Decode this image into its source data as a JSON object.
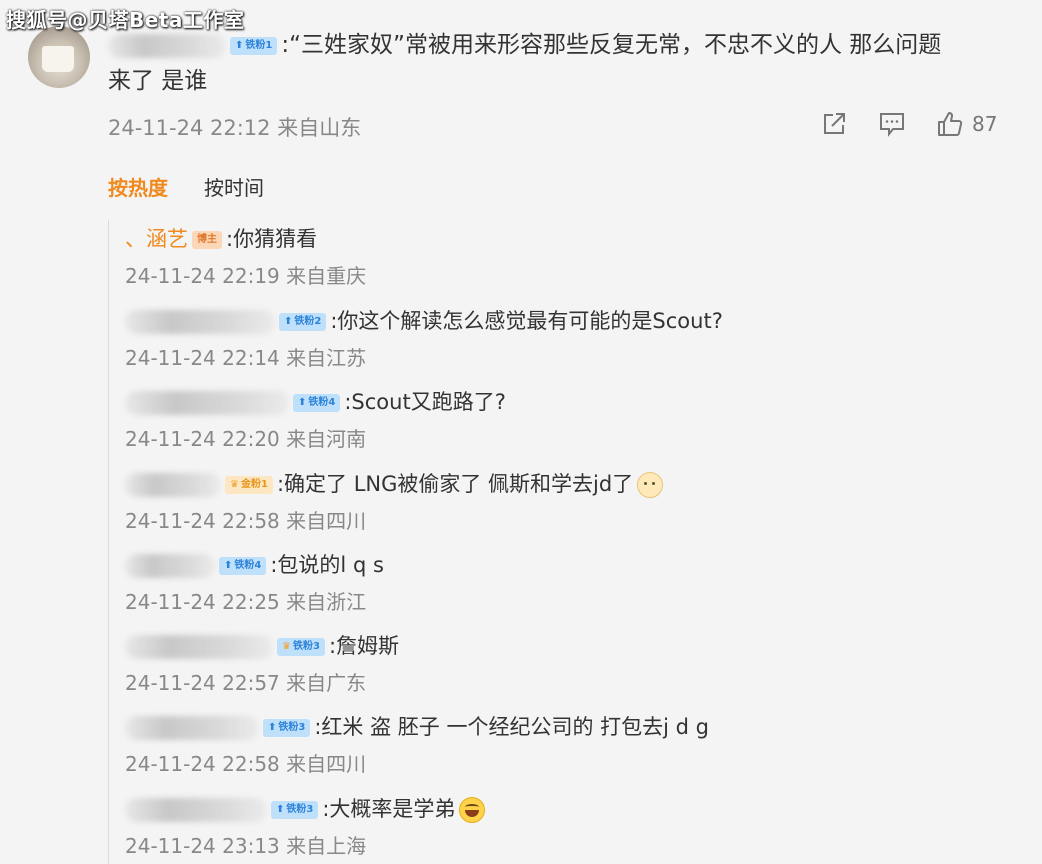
{
  "watermark": "搜狐号@贝塔Beta工作室",
  "main_comment": {
    "badge": "铁粉1",
    "text_line1": ":“三姓家奴”常被用来形容那些反复无常，不忠不义的人    那么问题",
    "text_line2": "来了  是谁",
    "time": "24-11-24 22:12 来自山东",
    "like_count": "87"
  },
  "tabs": {
    "hot": "按热度",
    "time": "按时间"
  },
  "replies": [
    {
      "name": "、涵艺",
      "badge": "博主",
      "text": ":你猜猜看",
      "time": "24-11-24 22:19 来自重庆"
    },
    {
      "badge": "铁粉2",
      "text": ":你这个解读怎么感觉最有可能的是Scout?",
      "time": "24-11-24 22:14 来自江苏"
    },
    {
      "badge": "铁粉4",
      "text": ":Scout又跑路了?",
      "time": "24-11-24 22:20 来自河南"
    },
    {
      "badge": "金粉1",
      "text": ":确定了 LNG被偷家了 佩斯和学去jd了",
      "time": "24-11-24 22:58 来自四川"
    },
    {
      "badge": "铁粉4",
      "text": ":包说的l q s",
      "time": "24-11-24 22:25 来自浙江"
    },
    {
      "badge": "铁粉3",
      "text": ":詹姆斯",
      "time": "24-11-24 22:57 来自广东"
    },
    {
      "badge": "铁粉3",
      "text": ":红米 盗 胚子 一个经纪公司的 打包去j d g",
      "time": "24-11-24 22:58 来自四川"
    },
    {
      "badge": "铁粉3",
      "text": ":大概率是学弟",
      "time": "24-11-24 23:13 来自上海"
    }
  ]
}
